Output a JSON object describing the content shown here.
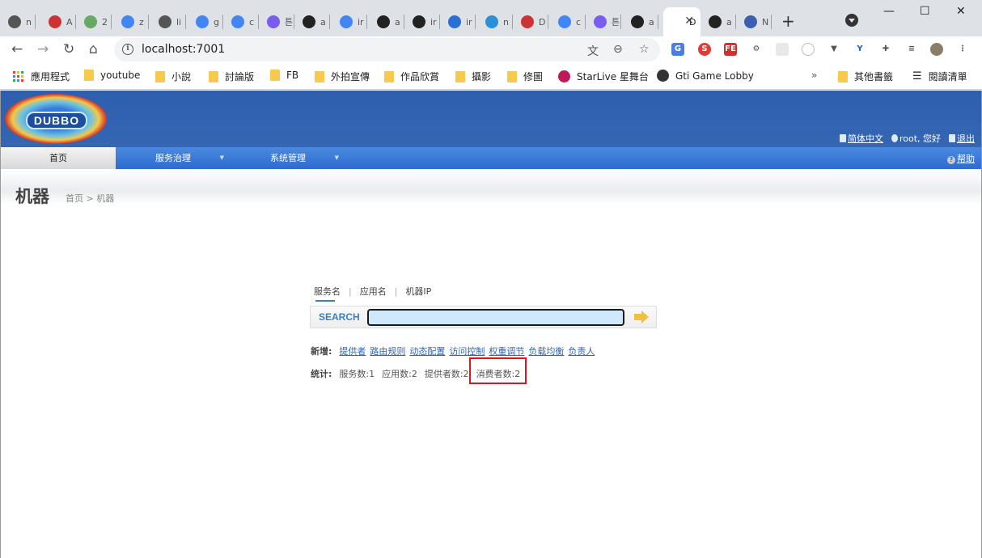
{
  "browser": {
    "tabs": [
      {
        "icon": "globe-icon",
        "label": "n",
        "color": "#555"
      },
      {
        "icon": "pen-icon",
        "label": "A",
        "color": "#c33"
      },
      {
        "icon": "badge-icon",
        "label": "2",
        "color": "#6a6"
      },
      {
        "icon": "google-icon",
        "label": "z",
        "color": "#4285f4"
      },
      {
        "icon": "globe-icon",
        "label": "li",
        "color": "#555"
      },
      {
        "icon": "google-icon",
        "label": "g",
        "color": "#4285f4"
      },
      {
        "icon": "google-icon",
        "label": "c",
        "color": "#4285f4"
      },
      {
        "icon": "d-icon",
        "label": "튼",
        "color": "#7b5cf0"
      },
      {
        "icon": "github-icon",
        "label": "a",
        "color": "#222"
      },
      {
        "icon": "google-icon",
        "label": "ir",
        "color": "#4285f4"
      },
      {
        "icon": "github-icon",
        "label": "a",
        "color": "#222"
      },
      {
        "icon": "github-icon",
        "label": "ir",
        "color": "#222"
      },
      {
        "icon": "jiao-icon",
        "label": "ir",
        "color": "#2a6fd6"
      },
      {
        "icon": "infinity-icon",
        "label": "n",
        "color": "#2a8fd6"
      },
      {
        "icon": "pen-icon",
        "label": "D",
        "color": "#c33"
      },
      {
        "icon": "google-icon",
        "label": "c",
        "color": "#4285f4"
      },
      {
        "icon": "d-icon",
        "label": "튼",
        "color": "#7b5cf0"
      },
      {
        "icon": "github-icon",
        "label": "a",
        "color": "#222"
      },
      {
        "icon": "dubbo-tab-icon",
        "label": "D",
        "color": "#ffffff",
        "active": true
      },
      {
        "icon": "github-icon",
        "label": "a",
        "color": "#222"
      },
      {
        "icon": "mvn-icon",
        "label": "N",
        "color": "#3a5fb0"
      }
    ],
    "url": "localhost:7001",
    "window_controls": [
      "—",
      "☐",
      "✕"
    ],
    "bookmarks": [
      {
        "label": "應用程式",
        "icon": "apps-icon"
      },
      {
        "label": "youtube",
        "icon": "folder-icon"
      },
      {
        "label": "小說",
        "icon": "folder-icon"
      },
      {
        "label": "討論版",
        "icon": "folder-icon"
      },
      {
        "label": "FB",
        "icon": "folder-icon"
      },
      {
        "label": "外拍宣傳",
        "icon": "folder-icon"
      },
      {
        "label": "作品欣賞",
        "icon": "folder-icon"
      },
      {
        "label": "攝影",
        "icon": "folder-icon"
      },
      {
        "label": "修圖",
        "icon": "folder-icon"
      },
      {
        "label": "StarLive 星舞台",
        "icon": "starlive-icon"
      },
      {
        "label": "Gti Game Lobby",
        "icon": "gti-icon"
      }
    ],
    "bookmarks_right": [
      {
        "label": "其他書籤",
        "icon": "folder-icon"
      },
      {
        "label": "閱讀清單",
        "icon": "reading-list-icon"
      }
    ]
  },
  "app": {
    "logo_text": "DUBBO",
    "lang_link": "简体中文",
    "user_text": "root, 您好",
    "logout": "退出",
    "help": "帮助",
    "menu": [
      {
        "label": "首页",
        "has_arrow": false
      },
      {
        "label": "服务治理",
        "has_arrow": true
      },
      {
        "label": "系统管理",
        "has_arrow": true
      }
    ],
    "page_title": "机器",
    "breadcrumb": "首页 > 机器"
  },
  "search": {
    "tabs": [
      "服务名",
      "应用名",
      "机器IP"
    ],
    "button_label": "SEARCH",
    "value": ""
  },
  "add_row": {
    "label": "新增:",
    "links": [
      "提供者",
      "路由规则",
      "动态配置",
      "访问控制",
      "权重调节",
      "负载均衡",
      "负责人"
    ]
  },
  "stats_row": {
    "label": "统计:",
    "items": [
      "服务数:1",
      "应用数:2",
      "提供者数:2",
      "消费者数:2"
    ]
  }
}
